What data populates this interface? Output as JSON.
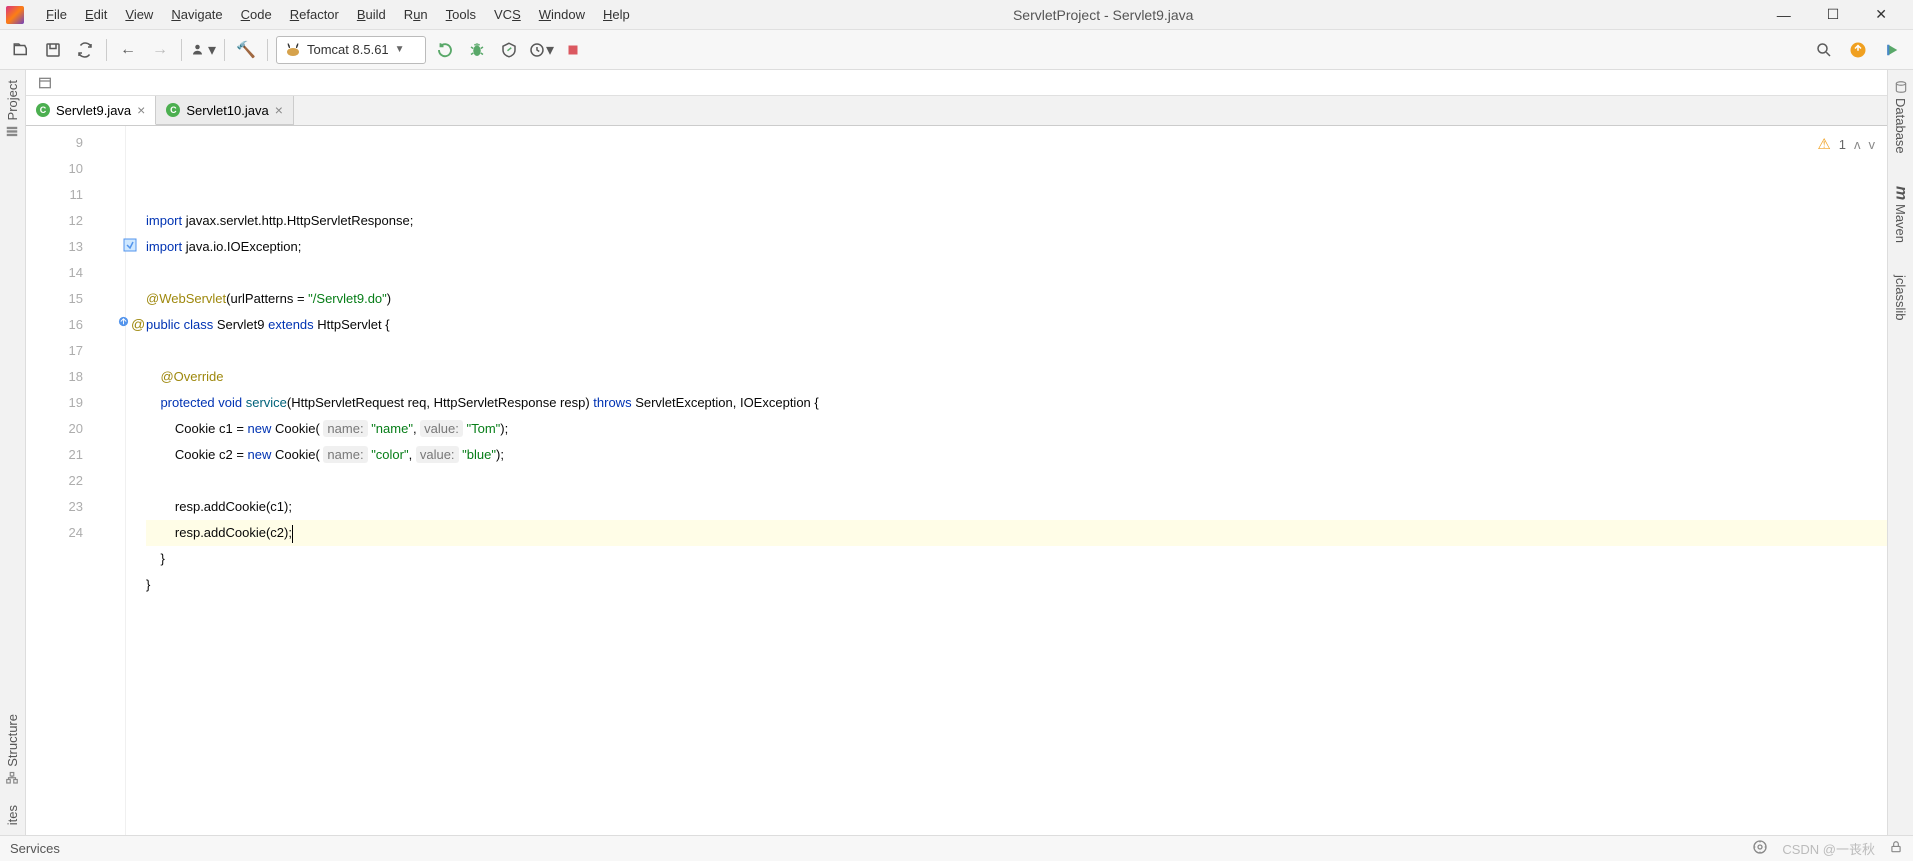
{
  "window": {
    "title": "ServletProject - Servlet9.java"
  },
  "menu": {
    "file": "File",
    "edit": "Edit",
    "view": "View",
    "navigate": "Navigate",
    "code": "Code",
    "refactor": "Refactor",
    "build": "Build",
    "run": "Run",
    "tools": "Tools",
    "vcs": "VCS",
    "window": "Window",
    "help": "Help"
  },
  "runConfig": {
    "label": "Tomcat 8.5.61"
  },
  "tabs": [
    {
      "label": "Servlet9.java",
      "active": true
    },
    {
      "label": "Servlet10.java",
      "active": false
    }
  ],
  "sidebars": {
    "left_project": "Project",
    "left_structure": "Structure",
    "left_favorites": "ites",
    "right_database": "Database",
    "right_maven": "Maven",
    "right_jclasslib": "jclasslib"
  },
  "warnings": {
    "count": "1"
  },
  "status": {
    "left": "Services",
    "watermark": "CSDN @一丧秋"
  },
  "code": {
    "lines": [
      {
        "n": 9,
        "segments": [
          {
            "t": "import ",
            "c": "kw"
          },
          {
            "t": "javax.servlet.http.HttpServletResponse;"
          }
        ]
      },
      {
        "n": 10,
        "segments": [
          {
            "t": "import ",
            "c": "kw"
          },
          {
            "t": "java.io.IOException;"
          }
        ]
      },
      {
        "n": 11,
        "segments": []
      },
      {
        "n": 12,
        "segments": [
          {
            "t": "@WebServlet",
            "c": "ann"
          },
          {
            "t": "(urlPatterns = "
          },
          {
            "t": "\"/Servlet9.do\"",
            "c": "str"
          },
          {
            "t": ")"
          }
        ]
      },
      {
        "n": 13,
        "segments": [
          {
            "t": "public class ",
            "c": "kw"
          },
          {
            "t": "Servlet9 "
          },
          {
            "t": "extends ",
            "c": "kw"
          },
          {
            "t": "HttpServlet {"
          }
        ]
      },
      {
        "n": 14,
        "segments": []
      },
      {
        "n": 15,
        "indent": 1,
        "segments": [
          {
            "t": "@Override",
            "c": "ann"
          }
        ]
      },
      {
        "n": 16,
        "indent": 1,
        "segments": [
          {
            "t": "protected void ",
            "c": "kw"
          },
          {
            "t": "service",
            "c": "fn"
          },
          {
            "t": "(HttpServletRequest req, HttpServletResponse resp) "
          },
          {
            "t": "throws ",
            "c": "kw"
          },
          {
            "t": "ServletException, IOException {"
          }
        ]
      },
      {
        "n": 17,
        "indent": 2,
        "segments": [
          {
            "t": "Cookie c1 = "
          },
          {
            "t": "new ",
            "c": "kw"
          },
          {
            "t": "Cookie( "
          },
          {
            "t": "name:",
            "c": "hint"
          },
          {
            "t": " "
          },
          {
            "t": "\"name\"",
            "c": "str"
          },
          {
            "t": ", "
          },
          {
            "t": "value:",
            "c": "hint"
          },
          {
            "t": " "
          },
          {
            "t": "\"Tom\"",
            "c": "str"
          },
          {
            "t": ");"
          }
        ]
      },
      {
        "n": 18,
        "indent": 2,
        "segments": [
          {
            "t": "Cookie c2 = "
          },
          {
            "t": "new ",
            "c": "kw"
          },
          {
            "t": "Cookie( "
          },
          {
            "t": "name:",
            "c": "hint"
          },
          {
            "t": " "
          },
          {
            "t": "\"color\"",
            "c": "str"
          },
          {
            "t": ", "
          },
          {
            "t": "value:",
            "c": "hint"
          },
          {
            "t": " "
          },
          {
            "t": "\"blue\"",
            "c": "str"
          },
          {
            "t": ");"
          }
        ]
      },
      {
        "n": 19,
        "segments": []
      },
      {
        "n": 20,
        "indent": 2,
        "segments": [
          {
            "t": "resp.addCookie(c1);"
          }
        ]
      },
      {
        "n": 21,
        "indent": 2,
        "highlight": true,
        "segments": [
          {
            "t": "resp.addCookie(c2);"
          }
        ],
        "cursor": true
      },
      {
        "n": 22,
        "indent": 1,
        "segments": [
          {
            "t": "}"
          }
        ]
      },
      {
        "n": 23,
        "segments": [
          {
            "t": "}"
          }
        ]
      },
      {
        "n": 24,
        "segments": []
      }
    ]
  }
}
